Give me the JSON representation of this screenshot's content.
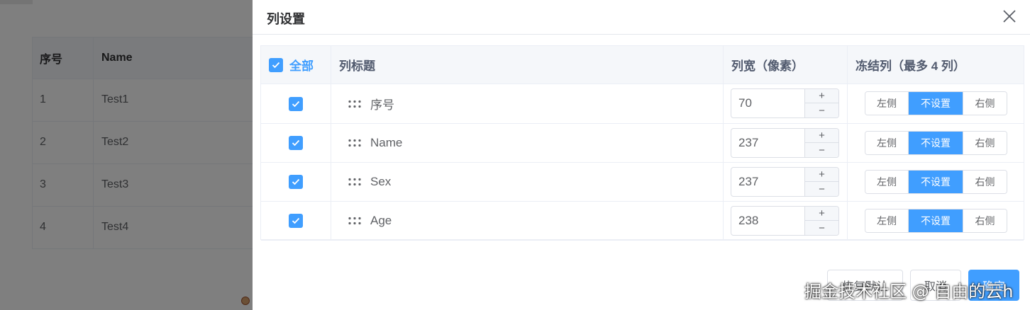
{
  "background_table": {
    "headers": [
      "序号",
      "Name"
    ],
    "rows": [
      [
        "1",
        "Test1"
      ],
      [
        "2",
        "Test2"
      ],
      [
        "3",
        "Test3"
      ],
      [
        "4",
        "Test4"
      ]
    ]
  },
  "drawer": {
    "title": "列设置",
    "close_icon": "close-icon"
  },
  "table": {
    "select_all_label": "全部",
    "headers": {
      "title": "列标题",
      "width": "列宽（像素）",
      "freeze": "冻结列（最多 4 列）"
    },
    "rows": [
      {
        "checked": true,
        "title": "序号",
        "width": "70",
        "freeze": "不设置"
      },
      {
        "checked": true,
        "title": "Name",
        "width": "237",
        "freeze": "不设置"
      },
      {
        "checked": true,
        "title": "Sex",
        "width": "237",
        "freeze": "不设置"
      },
      {
        "checked": true,
        "title": "Age",
        "width": "238",
        "freeze": "不设置"
      }
    ],
    "freeze_options": [
      "左侧",
      "不设置",
      "右侧"
    ],
    "stepper": {
      "plus": "+",
      "minus": "−"
    }
  },
  "footer": {
    "reset_label": "恢复默认",
    "cancel_label": "取消",
    "confirm_label": "确定"
  },
  "watermark": "掘金技术社区 @ 自由的云h",
  "colors": {
    "primary": "#409eff",
    "overlay": "rgba(0,0,0,0.5)",
    "header_bg": "#f5f7fa",
    "border": "#ebeef5"
  }
}
